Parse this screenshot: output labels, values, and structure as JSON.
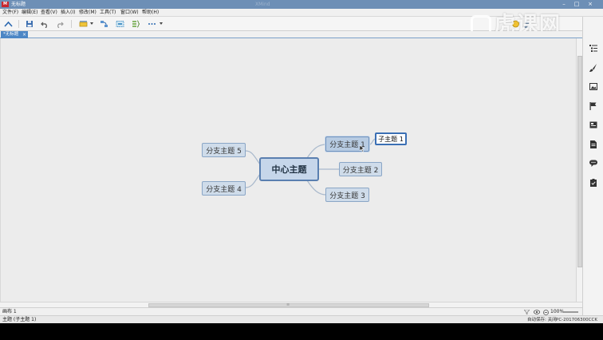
{
  "app": {
    "icon_label": "M",
    "title": "无标题",
    "faded_title": "XMind"
  },
  "menu": {
    "items": [
      "文件(F)",
      "编辑(E)",
      "查看(V)",
      "插入(I)",
      "修改(M)",
      "工具(T)",
      "窗口(W)",
      "帮助(H)"
    ]
  },
  "tab": {
    "label": "*无标题",
    "close": "×"
  },
  "mindmap": {
    "central": "中心主题",
    "branches": [
      "分支主题 1",
      "分支主题 2",
      "分支主题 3",
      "分支主题 4",
      "分支主题 5"
    ],
    "subtopic": "子主题 1"
  },
  "status": {
    "sheet": "画布 1",
    "zoom": "100%"
  },
  "info": {
    "selection": "主题 (子主题 1)",
    "autosave": "自动保存: 关闭",
    "host": "PC-201706300CCK"
  },
  "watermark": {
    "text": "虎课网"
  },
  "colors": {
    "accent": "#4c86c5",
    "topic_fill": "#cfdcea",
    "subtopic_border": "#3b6fb4",
    "connector": "#a9b9cc"
  }
}
